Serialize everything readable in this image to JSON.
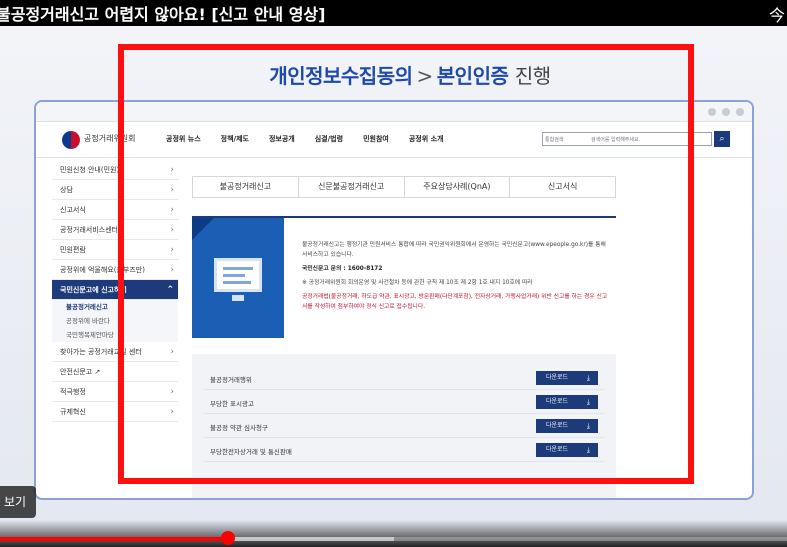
{
  "video": {
    "title": "불공정거래신고 어렵지 않아요! [신고 안내 영상]",
    "top_right_glyph": "今",
    "tooltip": "보기",
    "progress": {
      "played_fraction": 0.29,
      "buffered_fraction": 0.5
    }
  },
  "slide": {
    "heading_part1": "개인정보수집동의",
    "heading_separator": ">",
    "heading_part2": "본인인증",
    "heading_part3": "진행"
  },
  "site": {
    "name": "공정거래위원회",
    "nav": [
      "공정위 뉴스",
      "정책/제도",
      "정보공개",
      "심결/법령",
      "민원참여",
      "공정위 소개"
    ],
    "search": {
      "select_label": "통합검색",
      "placeholder": "검색어를 입력해주세요."
    },
    "search_button_icon": "search-icon"
  },
  "left_menu": {
    "items": [
      {
        "label": "민원신청 안내(민원)",
        "chevron": "›"
      },
      {
        "label": "상담",
        "chevron": "›"
      },
      {
        "label": "신고서식",
        "chevron": "›"
      },
      {
        "label": "공정거래서비스센터",
        "chevron": "›"
      },
      {
        "label": "민원편람",
        "chevron": "›"
      },
      {
        "label": "공정위에 억울해요(옴부즈만)",
        "chevron": "›"
      }
    ],
    "active_item": {
      "label": "국민신문고에 신고하기",
      "chevron": "⌃"
    },
    "sub_items": [
      "불공정거래신고",
      "공정위에 바란다",
      "국민행복제안마당"
    ],
    "items_after": [
      {
        "label": "찾아가는 공정거래교실 센터",
        "chevron": "›"
      },
      {
        "label": "안전신문고 ↗",
        "chevron": ""
      },
      {
        "label": "적극행정",
        "chevron": "›"
      },
      {
        "label": "규제혁신",
        "chevron": "›"
      }
    ]
  },
  "tabs": [
    "불공정거래신고",
    "신문불공정거래신고",
    "주요상담사례(QnA)",
    "신고서식"
  ],
  "info": {
    "line1": "불공정거래신고는 행정기관 민원서비스 통합에 따라 국민권익위원회에서 운영하는 국민신문고(www.epeople.go.kr)를 통해 서비스하고 있습니다.",
    "tel": "국민신문고 문의 : 1600-8172",
    "line2": "※ 공정거래위원회 회의운영 및 사건절차 등에 관한 규칙 제 10조 제 2항 1호 내지 10호에 따라",
    "line3_red": "공정거래법(불공정거래, 하도급 약관, 표시광고, 방문판매(다단계포함), 전자상거래, 가맹사업거래) 위반 신고를 하는 경우 신고서를 작성하여 첨부하여야 정식 신고로 접수됩니다."
  },
  "downloads": {
    "button_label": "다운로드",
    "button_icon": "download-icon",
    "rows": [
      "불공정거래행위",
      "부당한 표시광고",
      "불공정 약관 심사청구",
      "부당한전자상거래 및 통신판매"
    ]
  }
}
